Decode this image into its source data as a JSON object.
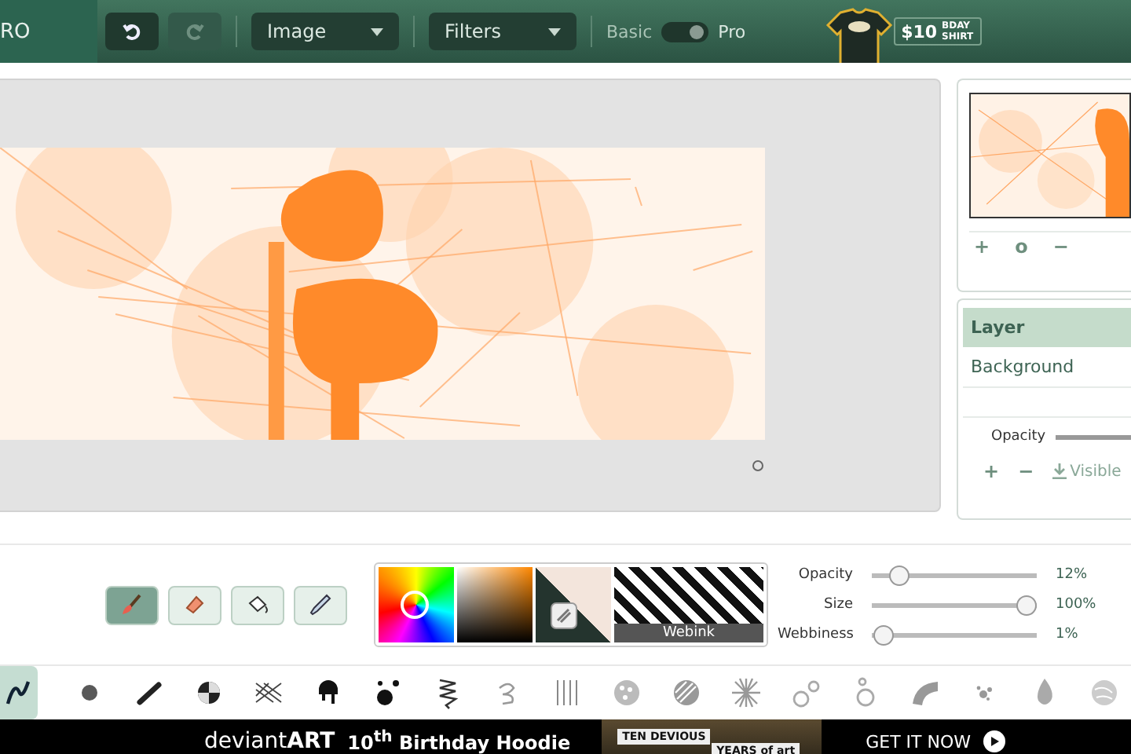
{
  "app_title": "RO",
  "toolbar": {
    "history": [
      {
        "kind": "undo",
        "disabled": false
      },
      {
        "kind": "redo",
        "disabled": true
      }
    ],
    "menus": [
      "Image",
      "Filters"
    ],
    "mode": [
      {
        "label": "Basic",
        "selected": false
      },
      {
        "label": "Pro",
        "selected": true
      }
    ],
    "promo": {
      "price": "$10",
      "line1": "BDAY",
      "line2": "SHIRT"
    }
  },
  "navigator": {
    "buttons": [
      "+",
      "o",
      "−"
    ]
  },
  "layers": {
    "header": "Layer",
    "rows": [
      {
        "name": "Background",
        "selected": false
      }
    ],
    "opacity_label": "Opacity",
    "opacity": {
      "level": 1
    },
    "buttons": [
      "+",
      "−"
    ],
    "visible_label": "Visible"
  },
  "tools": [
    {
      "kind": "brush",
      "selected": true
    },
    {
      "kind": "eraser",
      "selected": false
    },
    {
      "kind": "fill",
      "selected": false
    },
    {
      "kind": "eyedropper",
      "selected": false
    }
  ],
  "color": {
    "texture_label": "Webink"
  },
  "sliders": [
    {
      "label": "Opacity",
      "level": 0.12,
      "reading": "12%"
    },
    {
      "label": "Size",
      "level": 1,
      "reading": "100%"
    },
    {
      "label": "Webbiness",
      "level": 0.01,
      "reading": "1%"
    }
  ],
  "brushes": [
    {
      "kind": "squiggle",
      "selected": true
    },
    {
      "kind": "soft",
      "selected": false
    },
    {
      "kind": "stroke",
      "selected": false
    },
    {
      "kind": "half",
      "selected": false
    },
    {
      "kind": "hatch",
      "selected": false
    },
    {
      "kind": "drip",
      "selected": false
    },
    {
      "kind": "dots",
      "selected": false
    },
    {
      "kind": "spring",
      "selected": false
    },
    {
      "kind": "curl",
      "selected": false
    },
    {
      "kind": "lines",
      "selected": false
    },
    {
      "kind": "dotball",
      "selected": false
    },
    {
      "kind": "diagonal",
      "selected": false
    },
    {
      "kind": "burst",
      "selected": false
    },
    {
      "kind": "bubbles",
      "selected": false
    },
    {
      "kind": "rings",
      "selected": false
    },
    {
      "kind": "arc",
      "selected": false
    },
    {
      "kind": "splat",
      "selected": false
    },
    {
      "kind": "flame",
      "selected": false
    },
    {
      "kind": "texture",
      "selected": false
    }
  ],
  "ad": {
    "brand": "deviant**ART**",
    "title": "10$^{th}$ Birthday Hoodie",
    "badge1": "TEN DEVIOUS",
    "badge2": "YEARS of art",
    "cta": "GET IT NOW"
  }
}
